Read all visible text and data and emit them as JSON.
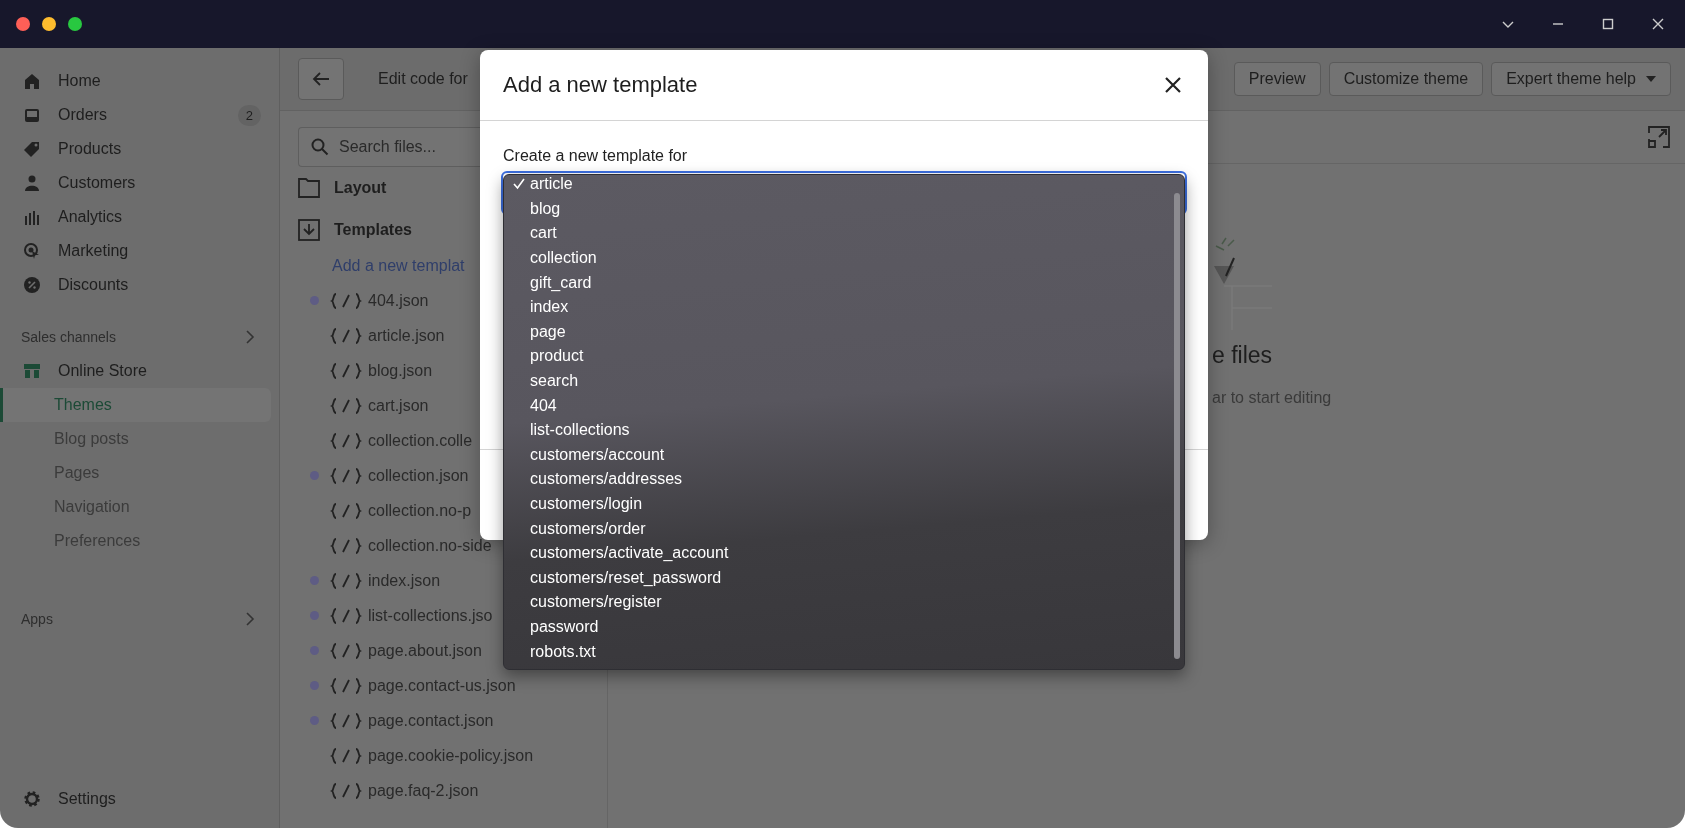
{
  "sidebar": {
    "items": [
      {
        "label": "Home"
      },
      {
        "label": "Orders",
        "badge": "2"
      },
      {
        "label": "Products"
      },
      {
        "label": "Customers"
      },
      {
        "label": "Analytics"
      },
      {
        "label": "Marketing"
      },
      {
        "label": "Discounts"
      }
    ],
    "sales_channels": {
      "label": "Sales channels",
      "channel": {
        "label": "Online Store",
        "children": [
          {
            "label": "Themes",
            "selected": true
          },
          {
            "label": "Blog posts",
            "selected": false
          },
          {
            "label": "Pages",
            "selected": false
          },
          {
            "label": "Navigation",
            "selected": false
          },
          {
            "label": "Preferences",
            "selected": false
          }
        ]
      }
    },
    "apps": {
      "label": "Apps"
    },
    "settings": {
      "label": "Settings"
    }
  },
  "header": {
    "title": "Edit code for",
    "buttons": [
      "Preview",
      "Customize theme"
    ],
    "menu_button": "Expert theme help"
  },
  "files": {
    "search": {
      "placeholder": "Search files..."
    },
    "folders": [
      {
        "label": "Layout",
        "kind": "folder"
      },
      {
        "label": "Templates",
        "kind": "download"
      }
    ],
    "add_link": "Add a new templat",
    "items": [
      {
        "name": "404.json",
        "modified": true
      },
      {
        "name": "article.json",
        "modified": false
      },
      {
        "name": "blog.json",
        "modified": false
      },
      {
        "name": "cart.json",
        "modified": false
      },
      {
        "name": "collection.colle",
        "modified": false
      },
      {
        "name": "collection.json",
        "modified": true
      },
      {
        "name": "collection.no-p",
        "modified": false
      },
      {
        "name": "collection.no-side",
        "modified": false
      },
      {
        "name": "index.json",
        "modified": true
      },
      {
        "name": "list-collections.jso",
        "modified": true
      },
      {
        "name": "page.about.json",
        "modified": true
      },
      {
        "name": "page.contact-us.json",
        "modified": true
      },
      {
        "name": "page.contact.json",
        "modified": true
      },
      {
        "name": "page.cookie-policy.json",
        "modified": false
      },
      {
        "name": "page.faq-2.json",
        "modified": false
      }
    ]
  },
  "editor": {
    "heading": "e files",
    "hint": "ar to start editing"
  },
  "dialog": {
    "title": "Add a new template",
    "label": "Create a new template for",
    "options": [
      {
        "label": "article",
        "selected": true
      },
      {
        "label": "blog",
        "selected": false
      },
      {
        "label": "cart",
        "selected": false
      },
      {
        "label": "collection",
        "selected": false
      },
      {
        "label": "gift_card",
        "selected": false
      },
      {
        "label": "index",
        "selected": false
      },
      {
        "label": "page",
        "selected": false
      },
      {
        "label": "product",
        "selected": false
      },
      {
        "label": "search",
        "selected": false
      },
      {
        "label": "404",
        "selected": false
      },
      {
        "label": "list-collections",
        "selected": false
      },
      {
        "label": "customers/account",
        "selected": false
      },
      {
        "label": "customers/addresses",
        "selected": false
      },
      {
        "label": "customers/login",
        "selected": false
      },
      {
        "label": "customers/order",
        "selected": false
      },
      {
        "label": "customers/activate_account",
        "selected": false
      },
      {
        "label": "customers/reset_password",
        "selected": false
      },
      {
        "label": "customers/register",
        "selected": false
      },
      {
        "label": "password",
        "selected": false
      },
      {
        "label": "robots.txt",
        "selected": false
      }
    ]
  }
}
